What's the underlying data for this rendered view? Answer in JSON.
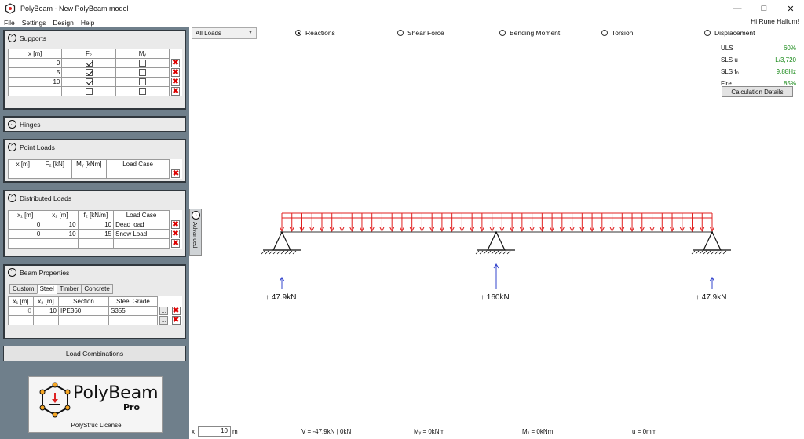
{
  "window": {
    "title": "PolyBeam - New PolyBeam model"
  },
  "menu": {
    "items": [
      "File",
      "Settings",
      "Design",
      "Help"
    ],
    "greeting": "Hi Rune Hallum!"
  },
  "supports": {
    "title": "Supports",
    "headers": [
      "x [m]",
      "F₂",
      "Mᵧ"
    ],
    "rows": [
      {
        "x": "0",
        "fz": true,
        "my": false
      },
      {
        "x": "5",
        "fz": true,
        "my": false
      },
      {
        "x": "10",
        "fz": true,
        "my": false
      },
      {
        "x": "",
        "fz": false,
        "my": false
      }
    ]
  },
  "hinges": {
    "title": "Hinges"
  },
  "point_loads": {
    "title": "Point Loads",
    "headers": [
      "x [m]",
      "F₂ [kN]",
      "Mᵧ [kNm]",
      "Load Case"
    ]
  },
  "distributed_loads": {
    "title": "Distributed Loads",
    "headers": [
      "x₁ [m]",
      "x₂ [m]",
      "f₂ [kN/m]",
      "Load Case"
    ],
    "rows": [
      {
        "x1": "0",
        "x2": "10",
        "f": "10",
        "case": "Dead load"
      },
      {
        "x1": "0",
        "x2": "10",
        "f": "15",
        "case": "Snow Load"
      },
      {
        "x1": "",
        "x2": "",
        "f": "",
        "case": ""
      }
    ]
  },
  "beam_properties": {
    "title": "Beam Properties",
    "tabs": [
      "Custom",
      "Steel",
      "Timber",
      "Concrete"
    ],
    "active_tab": "Steel",
    "headers": [
      "x₁ [m]",
      "x₂ [m]",
      "Section",
      "Steel Grade"
    ],
    "rows": [
      {
        "x1": "0",
        "x2": "10",
        "section": "IPE360",
        "grade": "S355"
      },
      {
        "x1": "",
        "x2": "",
        "section": "",
        "grade": ""
      }
    ]
  },
  "load_combinations_label": "Load Combinations",
  "logo": {
    "name": "PolyBeam",
    "edition": "Pro",
    "license": "PolyStruc License"
  },
  "advanced_label": "Advanced",
  "toolbar": {
    "load_select": "All Loads",
    "views": [
      "Reactions",
      "Shear Force",
      "Bending Moment",
      "Torsion",
      "Displacement"
    ],
    "selected_view": "Reactions"
  },
  "results": {
    "rows": [
      {
        "label": "ULS",
        "value": "60%"
      },
      {
        "label": "SLS u",
        "value": "L/3,720"
      },
      {
        "label": "SLS fₙ",
        "value": "9.88Hz"
      },
      {
        "label": "Fire",
        "value": "85%"
      }
    ],
    "calc_button": "Calculation Details"
  },
  "reactions": [
    {
      "label": "↑ 47.9kN",
      "value_kN": 47.9
    },
    {
      "label": "↑ 160kN",
      "value_kN": 160
    },
    {
      "label": "↑ 47.9kN",
      "value_kN": 47.9
    }
  ],
  "status": {
    "x_label": "x",
    "x_value": "10",
    "x_unit": "m",
    "v": "V =  -47.9kN | 0kN",
    "my": "Mᵧ = 0kNm",
    "mx": "Mₓ =   0kNm",
    "u": "u =   0mm"
  },
  "colors": {
    "load": "#e02020",
    "reaction": "#3344cc",
    "ok": "#1a8a1a",
    "panel_bg": "#6f7f8b"
  }
}
